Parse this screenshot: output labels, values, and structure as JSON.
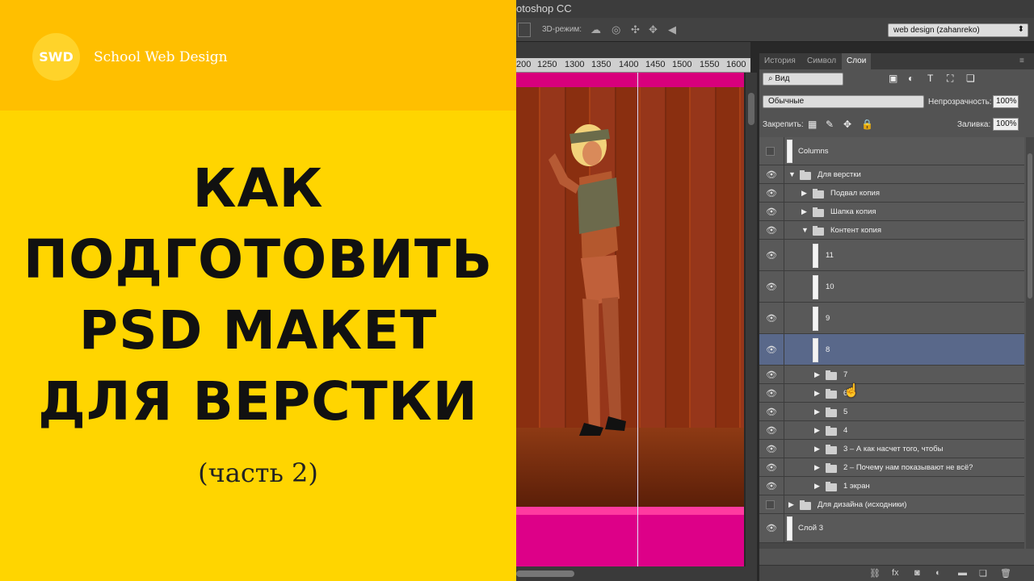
{
  "promo": {
    "logo": "SWD",
    "brand": "School Web Design",
    "title_lines": [
      "КАК",
      "ПОДГОТОВИТЬ",
      "PSD МАКЕТ",
      "ДЛЯ ВЕРСТКИ"
    ],
    "subtitle": "(часть 2)",
    "colors": {
      "background": "#ffd500",
      "topbar": "#ffbf00"
    }
  },
  "photoshop": {
    "title": "otoshop CC",
    "options_bar": {
      "mode_label": "3D-режим:",
      "workspace": "web design (zahanreko)"
    },
    "ruler_ticks": [
      "200",
      "1250",
      "1300",
      "1350",
      "1400",
      "1450",
      "1500",
      "1550",
      "1600"
    ],
    "panel": {
      "tabs": [
        "История",
        "Символ",
        "Слои"
      ],
      "active_tab": "Слои",
      "filter": "Вид",
      "blend_mode": "Обычные",
      "opacity_label": "Непрозрачность:",
      "opacity": "100%",
      "lock_label": "Закрепить:",
      "fill_label": "Заливка:",
      "fill": "100%"
    },
    "layers": [
      {
        "name": "Columns",
        "visible": false,
        "kind": "layer",
        "indent": 0
      },
      {
        "name": "Для верстки",
        "visible": true,
        "kind": "group-open",
        "indent": 0
      },
      {
        "name": "Подвал копия",
        "visible": true,
        "kind": "group",
        "indent": 1
      },
      {
        "name": "Шапка копия",
        "visible": true,
        "kind": "group",
        "indent": 1
      },
      {
        "name": "Контент копия",
        "visible": true,
        "kind": "group-open",
        "indent": 1
      },
      {
        "name": "11",
        "visible": true,
        "kind": "layer",
        "indent": 2
      },
      {
        "name": "10",
        "visible": true,
        "kind": "layer",
        "indent": 2
      },
      {
        "name": "9",
        "visible": true,
        "kind": "layer",
        "indent": 2
      },
      {
        "name": "8",
        "visible": true,
        "kind": "layer",
        "indent": 2,
        "selected": true
      },
      {
        "name": "7",
        "visible": true,
        "kind": "group",
        "indent": 2
      },
      {
        "name": "6",
        "visible": true,
        "kind": "group",
        "indent": 2
      },
      {
        "name": "5",
        "visible": true,
        "kind": "group",
        "indent": 2
      },
      {
        "name": "4",
        "visible": true,
        "kind": "group",
        "indent": 2
      },
      {
        "name": "3 – А как насчет того,  чтобы",
        "visible": true,
        "kind": "group",
        "indent": 2
      },
      {
        "name": "2 – Почему нам показывают не всё?",
        "visible": true,
        "kind": "group",
        "indent": 2
      },
      {
        "name": "1 экран",
        "visible": true,
        "kind": "group",
        "indent": 2
      },
      {
        "name": "Для дизайна (исходники)",
        "visible": false,
        "kind": "group",
        "indent": 0
      },
      {
        "name": "Слой 3",
        "visible": true,
        "kind": "layer",
        "indent": 0
      }
    ],
    "footer_icons": [
      "link-icon",
      "fx-icon",
      "mask-icon",
      "adjustment-icon",
      "new-group-icon",
      "new-layer-icon",
      "trash-icon"
    ]
  }
}
